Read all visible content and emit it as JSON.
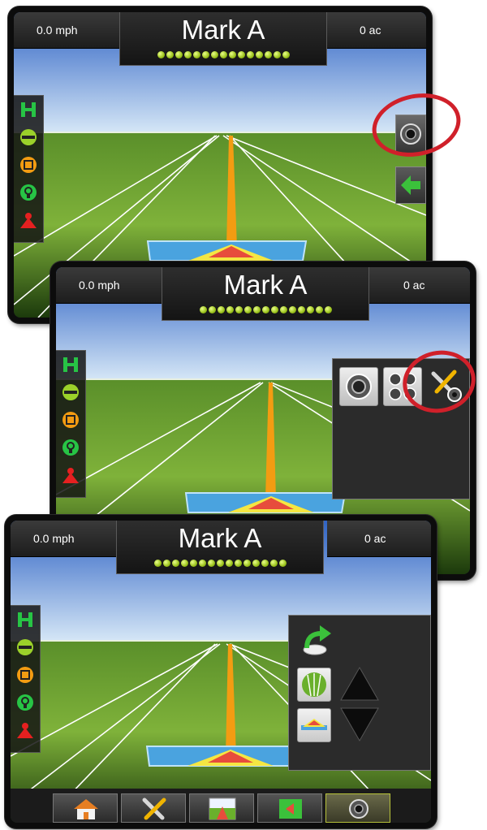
{
  "screens": [
    {
      "speed": "0.0 mph",
      "mark": "Mark A",
      "area": "0 ac",
      "side_buttons": [
        "camera-icon",
        "arrow-left-icon"
      ]
    },
    {
      "speed": "0.0 mph",
      "mark": "Mark A",
      "area": "0 ac",
      "menu_buttons": [
        "camera-icon",
        "multi-camera-icon",
        "tools-camera-icon"
      ]
    },
    {
      "speed": "0.0 mph",
      "mark": "Mark A",
      "area": "0 ac",
      "panel_buttons": [
        "rotate-arrow-icon",
        "overhead-view-icon",
        "perspective-view-icon",
        "up-arrow-icon",
        "down-arrow-icon"
      ],
      "nav_items": [
        "home-icon",
        "tools-icon",
        "guidance-icon",
        "map-icon",
        "camera-icon"
      ]
    }
  ],
  "guidance_lights": 15,
  "left_icons": [
    "boom-icon",
    "guidance-line-icon",
    "marker-icon",
    "gps-icon",
    "vehicle-icon"
  ],
  "colors": {
    "highlight_circle": "#d0202a",
    "nav_selected": "#b7c23a",
    "light_bar": "#9ac11b"
  }
}
